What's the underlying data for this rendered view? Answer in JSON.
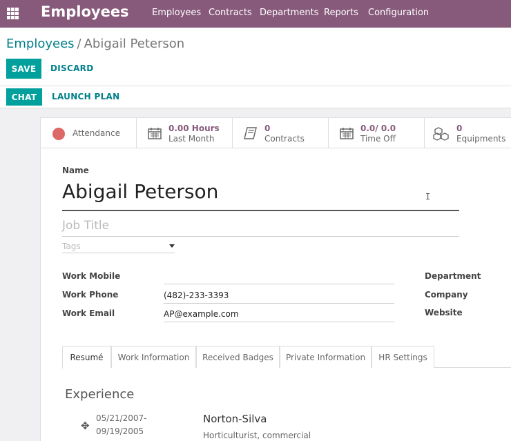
{
  "navbar": {
    "app_title": "Employees",
    "menu": [
      "Employees",
      "Contracts",
      "Departments",
      "Reports",
      "Configuration"
    ],
    "background": "#875a7b"
  },
  "breadcrumb": {
    "parent": "Employees",
    "separator": "/",
    "current": "Abigail Peterson"
  },
  "actions": {
    "save": "SAVE",
    "discard": "DISCARD",
    "chat": "CHAT",
    "launch_plan": "LAUNCH PLAN"
  },
  "smart_buttons": {
    "attendance": {
      "label": "Attendance",
      "status_color": "#dc6965"
    },
    "hours": {
      "value": "0.00 Hours",
      "label": "Last Month",
      "icon": "calendar-icon"
    },
    "contracts": {
      "value": "0",
      "label": "Contracts",
      "icon": "book-icon"
    },
    "time_off": {
      "value": "0.0/ 0.0",
      "label": "Time Off",
      "icon": "calendar-icon"
    },
    "equipments": {
      "value": "0",
      "label": "Equipments",
      "icon": "cubes-icon"
    }
  },
  "form": {
    "name_label": "Name",
    "name": "Abigail Peterson",
    "job_title_placeholder": "Job Title",
    "tags_placeholder": "Tags",
    "fields": {
      "work_mobile_label": "Work Mobile",
      "work_mobile": "",
      "work_phone_label": "Work Phone",
      "work_phone": "(482)-233-3393",
      "work_email_label": "Work Email",
      "work_email": "AP@example.com",
      "department_label": "Department",
      "company_label": "Company",
      "website_label": "Website"
    }
  },
  "tabs": [
    "Resumé",
    "Work Information",
    "Received Badges",
    "Private Information",
    "HR Settings"
  ],
  "resume": {
    "section_title": "Experience",
    "entries": [
      {
        "date_start": "05/21/2007-",
        "date_end": "09/19/2005",
        "company": "Norton-Silva",
        "role": "Horticulturist, commercial"
      }
    ]
  }
}
